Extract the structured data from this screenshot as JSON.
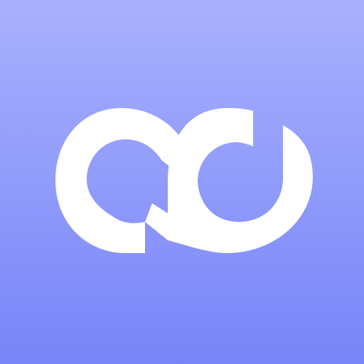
{
  "icon": {
    "logo_mark": "infinity-ad-logo-icon",
    "colors": {
      "gradient_top": "#A9B1FD",
      "gradient_bottom": "#7885F8",
      "mark": "#FFFFFF"
    }
  }
}
